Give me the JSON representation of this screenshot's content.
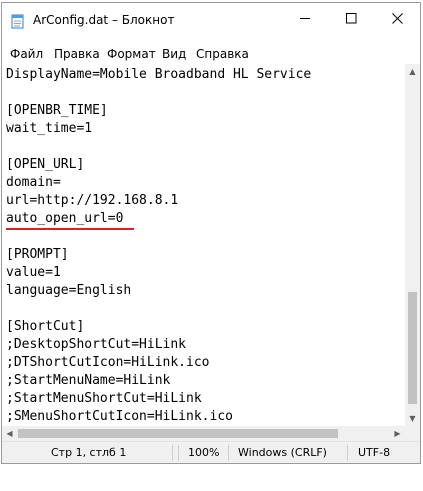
{
  "window": {
    "title": "ArConfig.dat – Блокнот"
  },
  "menu": [
    "Файл",
    "Правка",
    "Формат",
    "Вид",
    "Справка"
  ],
  "editor": {
    "lines": [
      "DisplayName=Mobile Broadband HL Service",
      "",
      "[OPENBR_TIME]",
      "wait_time=1",
      "",
      "[OPEN_URL]",
      "domain=",
      "url=http://192.168.8.1",
      "auto_open_url=0",
      "",
      "[PROMPT]",
      "value=1",
      "language=English",
      "",
      "[ShortCut]",
      ";DesktopShortCut=HiLink",
      ";DTShortCutIcon=HiLink.ico",
      ";StartMenuName=HiLink",
      ";StartMenuShortCut=HiLink",
      ";SMenuShortCutIcon=HiLink.ico"
    ]
  },
  "status": {
    "position": "Стр 1, стлб 1",
    "zoom": "100%",
    "line_endings": "Windows (CRLF)",
    "encoding": "UTF-8"
  },
  "colors": {
    "highlight": "#e02020",
    "statusbar": "#f0f0f0"
  }
}
